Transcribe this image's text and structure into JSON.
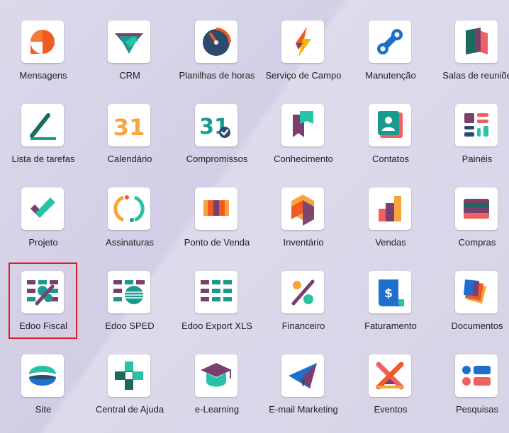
{
  "apps": [
    {
      "label": "Mensagens",
      "icon": "messages-icon"
    },
    {
      "label": "CRM",
      "icon": "crm-icon"
    },
    {
      "label": "Planilhas de horas",
      "icon": "timesheet-icon"
    },
    {
      "label": "Serviço de Campo",
      "icon": "field-service-icon"
    },
    {
      "label": "Manutenção",
      "icon": "maintenance-icon"
    },
    {
      "label": "Salas de reuniõe",
      "icon": "meeting-rooms-icon"
    },
    {
      "label": "Lista de tarefas",
      "icon": "todo-icon"
    },
    {
      "label": "Calendário",
      "icon": "calendar-icon"
    },
    {
      "label": "Compromissos",
      "icon": "appointments-icon"
    },
    {
      "label": "Conhecimento",
      "icon": "knowledge-icon"
    },
    {
      "label": "Contatos",
      "icon": "contacts-icon"
    },
    {
      "label": "Painéis",
      "icon": "dashboards-icon"
    },
    {
      "label": "Projeto",
      "icon": "project-icon"
    },
    {
      "label": "Assinaturas",
      "icon": "subscriptions-icon"
    },
    {
      "label": "Ponto de Venda",
      "icon": "point-of-sale-icon"
    },
    {
      "label": "Inventário",
      "icon": "inventory-icon"
    },
    {
      "label": "Vendas",
      "icon": "sales-icon"
    },
    {
      "label": "Compras",
      "icon": "purchase-icon"
    },
    {
      "label": "Edoo Fiscal",
      "icon": "edoo-fiscal-icon",
      "selected": true
    },
    {
      "label": "Edoo SPED",
      "icon": "edoo-sped-icon"
    },
    {
      "label": "Edoo Export XLS",
      "icon": "edoo-export-xls-icon"
    },
    {
      "label": "Financeiro",
      "icon": "accounting-icon"
    },
    {
      "label": "Faturamento",
      "icon": "invoicing-icon"
    },
    {
      "label": "Documentos",
      "icon": "documents-icon"
    },
    {
      "label": "Site",
      "icon": "website-icon"
    },
    {
      "label": "Central de Ajuda",
      "icon": "helpdesk-icon"
    },
    {
      "label": "e-Learning",
      "icon": "elearning-icon"
    },
    {
      "label": "E-mail Marketing",
      "icon": "email-marketing-icon"
    },
    {
      "label": "Eventos",
      "icon": "events-icon"
    },
    {
      "label": "Pesquisas",
      "icon": "surveys-icon"
    }
  ],
  "calendar_digits": "31",
  "colors": {
    "teal": "#1a9a8e",
    "purple": "#7b3f6e",
    "orange": "#f05a24",
    "selection": "#e01b24"
  }
}
